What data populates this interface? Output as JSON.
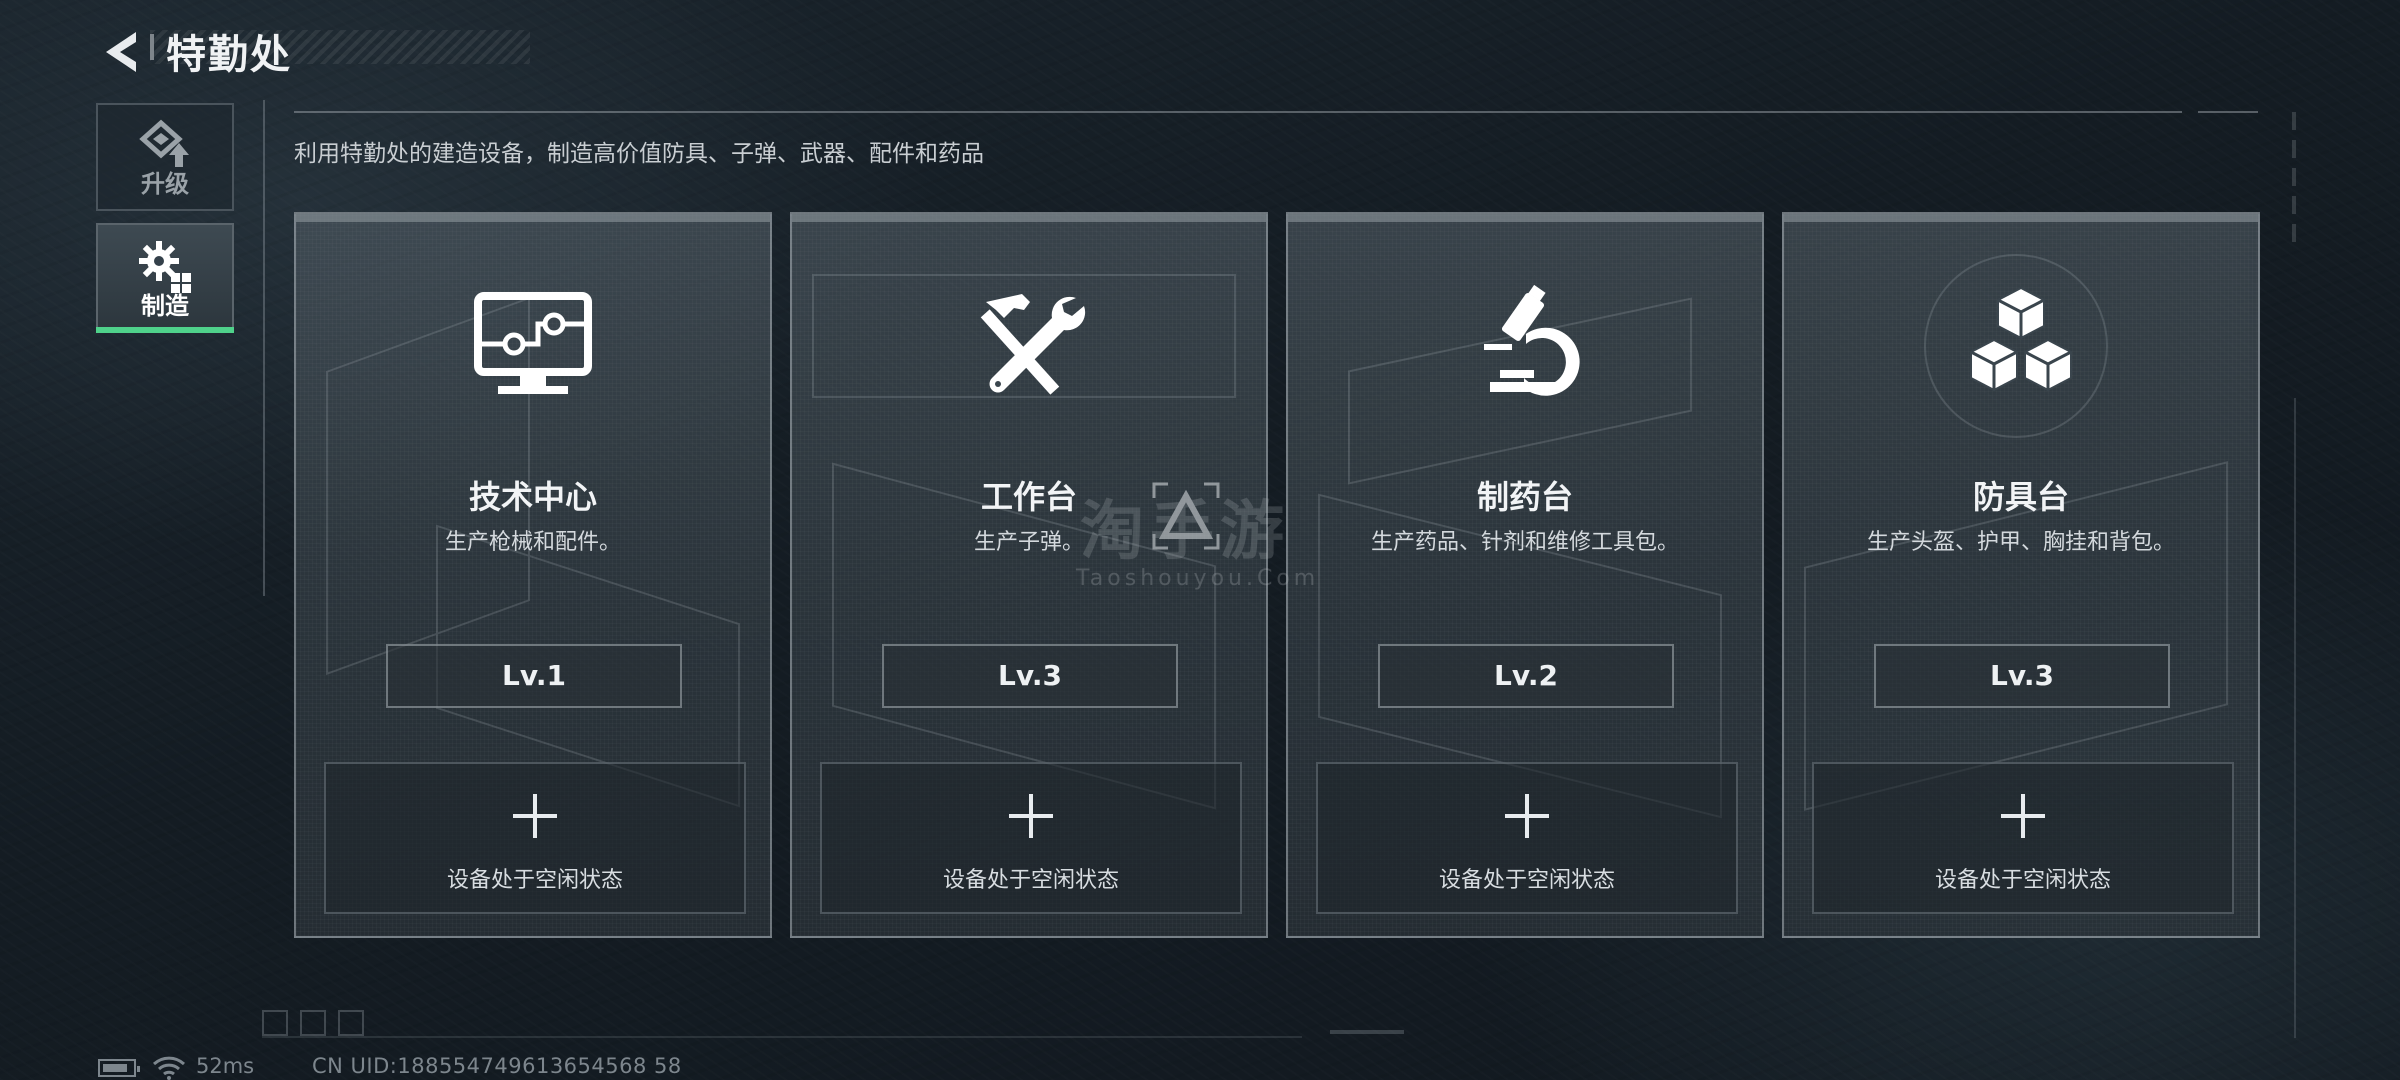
{
  "header": {
    "title": "特勤处"
  },
  "sidebar": {
    "items": [
      {
        "label": "升级",
        "icon": "upgrade-icon",
        "active": false
      },
      {
        "label": "制造",
        "icon": "gears-icon",
        "active": true
      }
    ]
  },
  "main": {
    "description": "利用特勤处的建造设备，制造高价值防具、子弹、武器、配件和药品",
    "stations": [
      {
        "name": "技术中心",
        "desc": "生产枪械和配件。",
        "level": "Lv.1",
        "status": "设备处于空闲状态",
        "icon": "monitor-icon"
      },
      {
        "name": "工作台",
        "desc": "生产子弹。",
        "level": "Lv.3",
        "status": "设备处于空闲状态",
        "icon": "hammer-wrench-icon"
      },
      {
        "name": "制药台",
        "desc": "生产药品、针剂和维修工具包。",
        "level": "Lv.2",
        "status": "设备处于空闲状态",
        "icon": "microscope-icon"
      },
      {
        "name": "防具台",
        "desc": "生产头盔、护甲、胸挂和背包。",
        "level": "Lv.3",
        "status": "设备处于空闲状态",
        "icon": "cubes-icon"
      }
    ]
  },
  "watermark": {
    "text": "淘手游",
    "sub": "Taoshouyou.Com"
  },
  "status_bar": {
    "ping": "52ms",
    "uid": "CN UID:188554749613654568 58"
  },
  "colors": {
    "accent_green": "#4fd28b",
    "background": "#151d24",
    "card_border": "#b4bcc2"
  }
}
